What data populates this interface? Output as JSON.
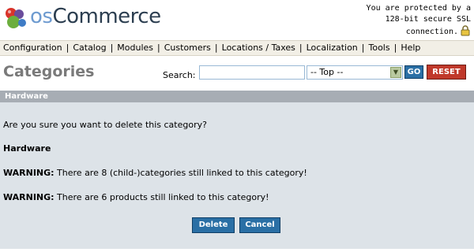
{
  "header": {
    "logo_prefix": "os",
    "logo_suffix": "Commerce",
    "ssl_line1": "You are protected by a",
    "ssl_line2": "128-bit secure SSL",
    "ssl_line3": "connection."
  },
  "menu": {
    "items": [
      {
        "label": "Configuration"
      },
      {
        "label": "Catalog"
      },
      {
        "label": "Modules"
      },
      {
        "label": "Customers"
      },
      {
        "label": "Locations / Taxes"
      },
      {
        "label": "Localization"
      },
      {
        "label": "Tools"
      },
      {
        "label": "Help"
      }
    ],
    "separator": "|"
  },
  "page": {
    "title": "Categories",
    "search_label": "Search:",
    "search_value": "",
    "category_select": "-- Top --",
    "go_label": "GO",
    "reset_label": "RESET"
  },
  "panel": {
    "header": "Hardware",
    "question": "Are you sure you want to delete this category?",
    "category_name": "Hardware",
    "warning_label": "WARNING:",
    "warning1_text": " There are 8 (child-)categories still linked to this category!",
    "warning2_text": " There are 6 products still linked to this category!",
    "delete_label": "Delete",
    "cancel_label": "Cancel"
  },
  "colors": {
    "menu_bg": "#f2efe6",
    "panel_header_bg": "#a7adb4",
    "panel_bg": "#dde3e8",
    "button_blue": "#2a6fa5",
    "button_red": "#c0392b"
  }
}
